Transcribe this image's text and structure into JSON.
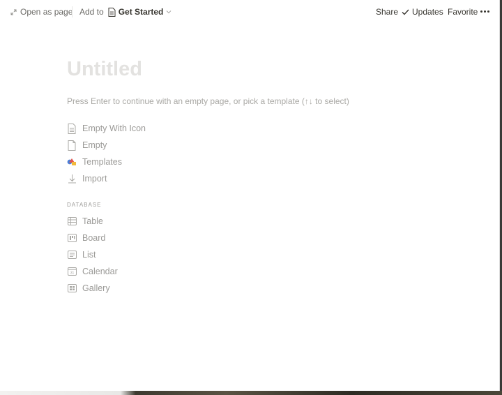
{
  "topbar": {
    "open_as_page": "Open as page",
    "add_to": "Add to",
    "page_name": "Get Started",
    "share": "Share",
    "updates": "Updates",
    "favorite": "Favorite"
  },
  "page": {
    "title_placeholder": "Untitled",
    "hint": "Press Enter to continue with an empty page, or pick a template (↑↓ to select)"
  },
  "templates": [
    {
      "label": "Empty With Icon",
      "icon": "page-with-lines-icon"
    },
    {
      "label": "Empty",
      "icon": "blank-page-icon"
    },
    {
      "label": "Templates",
      "icon": "templates-shapes-icon"
    },
    {
      "label": "Import",
      "icon": "download-arrow-icon"
    }
  ],
  "database": {
    "heading": "DATABASE",
    "items": [
      {
        "label": "Table",
        "icon": "table-icon"
      },
      {
        "label": "Board",
        "icon": "board-icon"
      },
      {
        "label": "List",
        "icon": "list-icon"
      },
      {
        "label": "Calendar",
        "icon": "calendar-icon",
        "icon_text": "31"
      },
      {
        "label": "Gallery",
        "icon": "gallery-icon"
      }
    ]
  },
  "colors": {
    "text": "#37352f",
    "muted": "#9b9a97",
    "title_placeholder": "#e3e2e0",
    "templates_red": "#e5534b",
    "templates_yellow": "#f2b93b",
    "templates_blue": "#4a7fd8"
  }
}
